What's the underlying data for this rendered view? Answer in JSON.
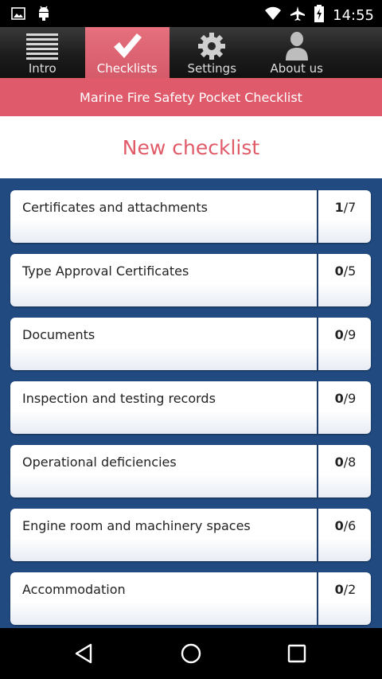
{
  "status": {
    "time": "14:55"
  },
  "tabs": [
    {
      "label": "Intro",
      "icon": "menu-lines-icon",
      "active": false
    },
    {
      "label": "Checklists",
      "icon": "checkmark-icon",
      "active": true
    },
    {
      "label": "Settings",
      "icon": "gear-icon",
      "active": false
    },
    {
      "label": "About us",
      "icon": "person-icon",
      "active": false
    }
  ],
  "banner": {
    "title": "Marine Fire Safety Pocket Checklist"
  },
  "header": {
    "title": "New checklist"
  },
  "items": [
    {
      "title": "Certificates and attachments",
      "done": "1",
      "total": "/7"
    },
    {
      "title": "Type Approval Certificates",
      "done": "0",
      "total": "/5"
    },
    {
      "title": "Documents",
      "done": "0",
      "total": "/9"
    },
    {
      "title": "Inspection and testing records",
      "done": "0",
      "total": "/9"
    },
    {
      "title": "Operational deficiencies",
      "done": "0",
      "total": "/8"
    },
    {
      "title": "Engine room and machinery spaces",
      "done": "0",
      "total": "/6"
    },
    {
      "title": "Accommodation",
      "done": "0",
      "total": "/2"
    }
  ],
  "colors": {
    "accent": "#df5a6a",
    "list_bg": "#214a80"
  }
}
